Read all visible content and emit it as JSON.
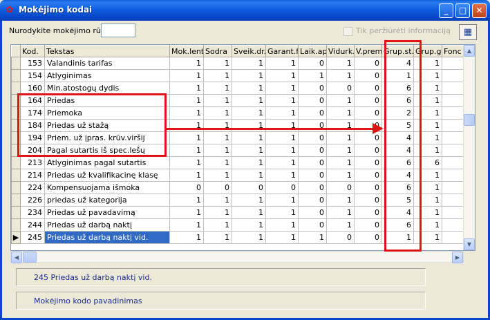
{
  "window": {
    "title": "Mokėjimo kodai"
  },
  "filter": {
    "code_label": "Nurodykite mokėjimo rūšį",
    "code_value": "",
    "view_only_label": "Tik peržiūrėti informaciją",
    "view_only_checked": false
  },
  "grid": {
    "columns": [
      "Kod.",
      "Tekstas",
      "Mok.lent.",
      "Sodra",
      "Sveik.dr.",
      "Garant.f",
      "Laik.aps",
      "Vidurk.",
      "V.prem",
      "Grup.st.",
      "Grup.ga",
      "Fonc"
    ],
    "rows": [
      [
        "153",
        "Valandinis tarifas",
        "1",
        "1",
        "1",
        "1",
        "0",
        "1",
        "0",
        "4",
        "1"
      ],
      [
        "154",
        "Atlyginimas",
        "1",
        "1",
        "1",
        "1",
        "1",
        "1",
        "0",
        "1",
        "1"
      ],
      [
        "160",
        "Min.atostogų dydis",
        "1",
        "1",
        "1",
        "1",
        "0",
        "0",
        "0",
        "6",
        "1"
      ],
      [
        "164",
        "Priedas",
        "1",
        "1",
        "1",
        "1",
        "0",
        "1",
        "0",
        "6",
        "1"
      ],
      [
        "174",
        "Priemoka",
        "1",
        "1",
        "1",
        "1",
        "0",
        "1",
        "0",
        "2",
        "1"
      ],
      [
        "184",
        "Priedas už stažą",
        "1",
        "1",
        "1",
        "1",
        "0",
        "1",
        "0",
        "5",
        "1"
      ],
      [
        "194",
        "Priem.  už įpras. krūv.viršij",
        "1",
        "1",
        "1",
        "1",
        "0",
        "1",
        "0",
        "4",
        "1"
      ],
      [
        "204",
        "Pagal sutartis iš spec.lešų",
        "1",
        "1",
        "1",
        "1",
        "0",
        "1",
        "0",
        "4",
        "1"
      ],
      [
        "213",
        "Atlyginimas pagal sutartis",
        "1",
        "1",
        "1",
        "1",
        "0",
        "1",
        "0",
        "6",
        "6"
      ],
      [
        "214",
        "Priedas už kvalifikacinę klasę",
        "1",
        "1",
        "1",
        "1",
        "0",
        "1",
        "0",
        "4",
        "1"
      ],
      [
        "224",
        "Kompensuojama išmoka",
        "0",
        "0",
        "0",
        "0",
        "0",
        "0",
        "0",
        "6",
        "1"
      ],
      [
        "226",
        "priedas už kategorija",
        "1",
        "1",
        "1",
        "1",
        "0",
        "1",
        "0",
        "5",
        "1"
      ],
      [
        "234",
        "Priedas už pavadavimą",
        "1",
        "1",
        "1",
        "1",
        "0",
        "1",
        "0",
        "4",
        "1"
      ],
      [
        "244",
        "Priedas už darbą naktį",
        "1",
        "1",
        "1",
        "1",
        "0",
        "1",
        "0",
        "6",
        "1"
      ],
      [
        "245",
        "Priedas už darbą naktį vid.",
        "1",
        "1",
        "1",
        "1",
        "1",
        "0",
        "0",
        "1",
        "1"
      ]
    ],
    "selected_row": 14
  },
  "status": {
    "selected_text": "245 Priedas už darbą naktį vid.",
    "field_caption": "Mokėjimo kodo pavadinimas"
  },
  "colors": {
    "titlebar": "#0845c8",
    "selection": "#316ac5",
    "highlight": "#e01414"
  }
}
